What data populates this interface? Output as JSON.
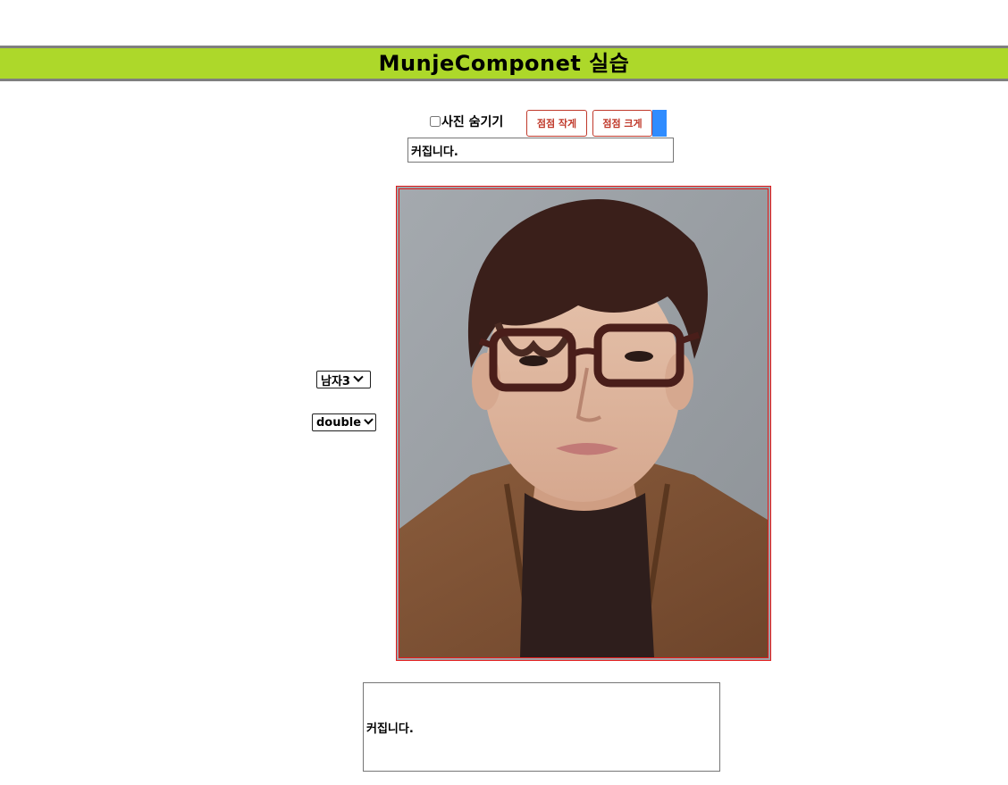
{
  "header": {
    "title": "MunjeComponet 실습"
  },
  "controls": {
    "hide_photo_label": "사진 숨기기",
    "hide_photo_checked": false,
    "smaller_button_label": "점점 작게",
    "bigger_button_label": "점점 크게",
    "accent_button_color": "#2f8cff",
    "text_input_value": "커집니다."
  },
  "selects": {
    "person": {
      "selected": "남자3"
    },
    "border_style": {
      "selected": "double"
    }
  },
  "photo": {
    "description_icon": "person-photo",
    "border_color": "#e01b1b",
    "border_style": "double"
  },
  "output": {
    "text": "커집니다."
  },
  "colors": {
    "header_bg": "#add82a",
    "header_border": "#7f7f7f",
    "button_text": "#c0392b"
  }
}
